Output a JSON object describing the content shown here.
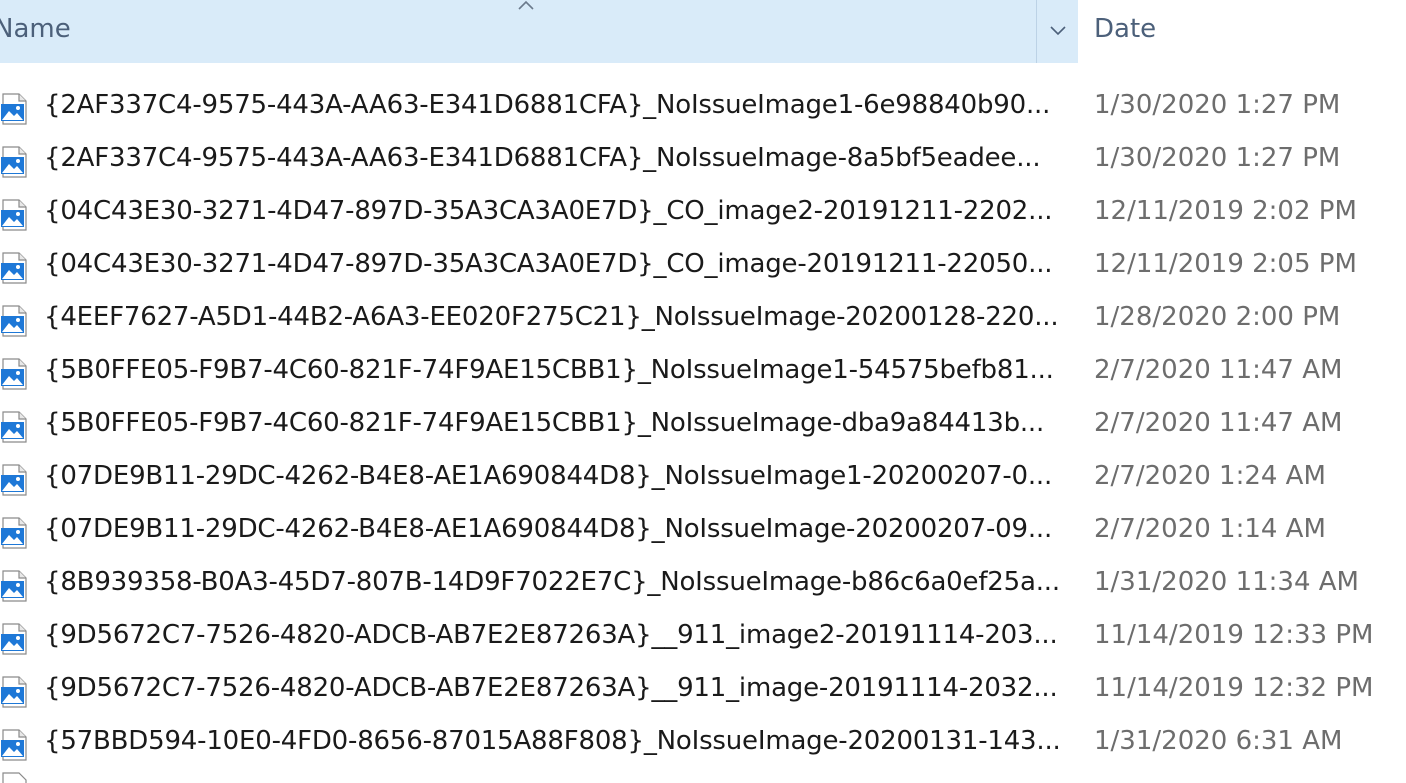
{
  "header": {
    "name_label": "Name",
    "date_label": "Date",
    "sort_icon": "sort-ascending-caret-icon",
    "dropdown_icon": "chevron-down-icon"
  },
  "colors": {
    "header_bg": "#d9ebf9",
    "header_text": "#4c607a",
    "name_text": "#1a1a1a",
    "date_text": "#6d6d6d",
    "icon_blue": "#1e78d7"
  },
  "files": [
    {
      "name": "{2AF337C4-9575-443A-AA63-E341D6881CFA}_NoIssueImage1-6e98840b90...",
      "date": "1/30/2020 1:27 PM",
      "icon": "image-file-icon"
    },
    {
      "name": "{2AF337C4-9575-443A-AA63-E341D6881CFA}_NoIssueImage-8a5bf5eadee...",
      "date": "1/30/2020 1:27 PM",
      "icon": "image-file-icon"
    },
    {
      "name": "{04C43E30-3271-4D47-897D-35A3CA3A0E7D}_CO_image2-20191211-2202...",
      "date": "12/11/2019 2:02 PM",
      "icon": "image-file-icon"
    },
    {
      "name": "{04C43E30-3271-4D47-897D-35A3CA3A0E7D}_CO_image-20191211-22050...",
      "date": "12/11/2019 2:05 PM",
      "icon": "image-file-icon"
    },
    {
      "name": "{4EEF7627-A5D1-44B2-A6A3-EE020F275C21}_NoIssueImage-20200128-220...",
      "date": "1/28/2020 2:00 PM",
      "icon": "image-file-icon"
    },
    {
      "name": "{5B0FFE05-F9B7-4C60-821F-74F9AE15CBB1}_NoIssueImage1-54575befb81...",
      "date": "2/7/2020 11:47 AM",
      "icon": "image-file-icon"
    },
    {
      "name": "{5B0FFE05-F9B7-4C60-821F-74F9AE15CBB1}_NoIssueImage-dba9a84413b...",
      "date": "2/7/2020 11:47 AM",
      "icon": "image-file-icon"
    },
    {
      "name": "{07DE9B11-29DC-4262-B4E8-AE1A690844D8}_NoIssueImage1-20200207-0...",
      "date": "2/7/2020 1:24 AM",
      "icon": "image-file-icon"
    },
    {
      "name": "{07DE9B11-29DC-4262-B4E8-AE1A690844D8}_NoIssueImage-20200207-09...",
      "date": "2/7/2020 1:14 AM",
      "icon": "image-file-icon"
    },
    {
      "name": "{8B939358-B0A3-45D7-807B-14D9F7022E7C}_NoIssueImage-b86c6a0ef25a...",
      "date": "1/31/2020 11:34 AM",
      "icon": "image-file-icon"
    },
    {
      "name": "{9D5672C7-7526-4820-ADCB-AB7E2E87263A}__911_image2-20191114-203...",
      "date": "11/14/2019 12:33 PM",
      "icon": "image-file-icon"
    },
    {
      "name": "{9D5672C7-7526-4820-ADCB-AB7E2E87263A}__911_image-20191114-2032...",
      "date": "11/14/2019 12:32 PM",
      "icon": "image-file-icon"
    },
    {
      "name": "{57BBD594-10E0-4FD0-8656-87015A88F808}_NoIssueImage-20200131-143...",
      "date": "1/31/2020 6:31 AM",
      "icon": "image-file-icon"
    }
  ]
}
